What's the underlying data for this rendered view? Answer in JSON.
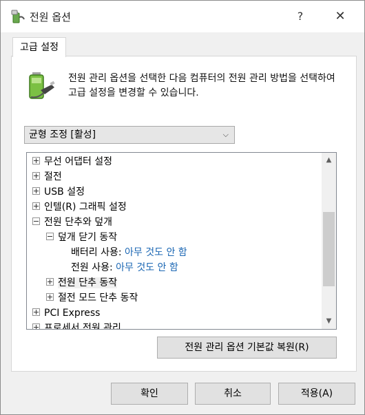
{
  "window": {
    "title": "전원 옵션",
    "help_glyph": "?",
    "close_glyph": "✕"
  },
  "tab": {
    "label": "고급 설정"
  },
  "description": "전원 관리 옵션을 선택한 다음 컴퓨터의 전원 관리 방법을 선택하여 고급 설정을 변경할 수 있습니다.",
  "scheme": {
    "selected": "균형 조정 [활성]",
    "arrow": "⌵"
  },
  "tree": {
    "wireless": "무선 어댑터 설정",
    "sleep": "절전",
    "usb": "USB 설정",
    "intel": "인텔(R) 그래픽 설정",
    "power_button_lid": "전원 단추와 덮개",
    "lid_close": "덮개 닫기 동작",
    "battery_label": "배터리 사용:",
    "battery_value": "아무 것도 안 함",
    "plugged_label": "전원 사용:",
    "plugged_value": "아무 것도 안 함",
    "power_button": "전원 단추 동작",
    "sleep_button": "절전 모드 단추 동작",
    "pci": "PCI Express",
    "processor": "프로세서 전원 관리"
  },
  "buttons": {
    "restore": "전원 관리 옵션 기본값 복원(R)",
    "ok": "확인",
    "cancel": "취소",
    "apply": "적용(A)"
  },
  "icons": {
    "app": "power-options-icon",
    "battery": "battery-plug-icon"
  }
}
